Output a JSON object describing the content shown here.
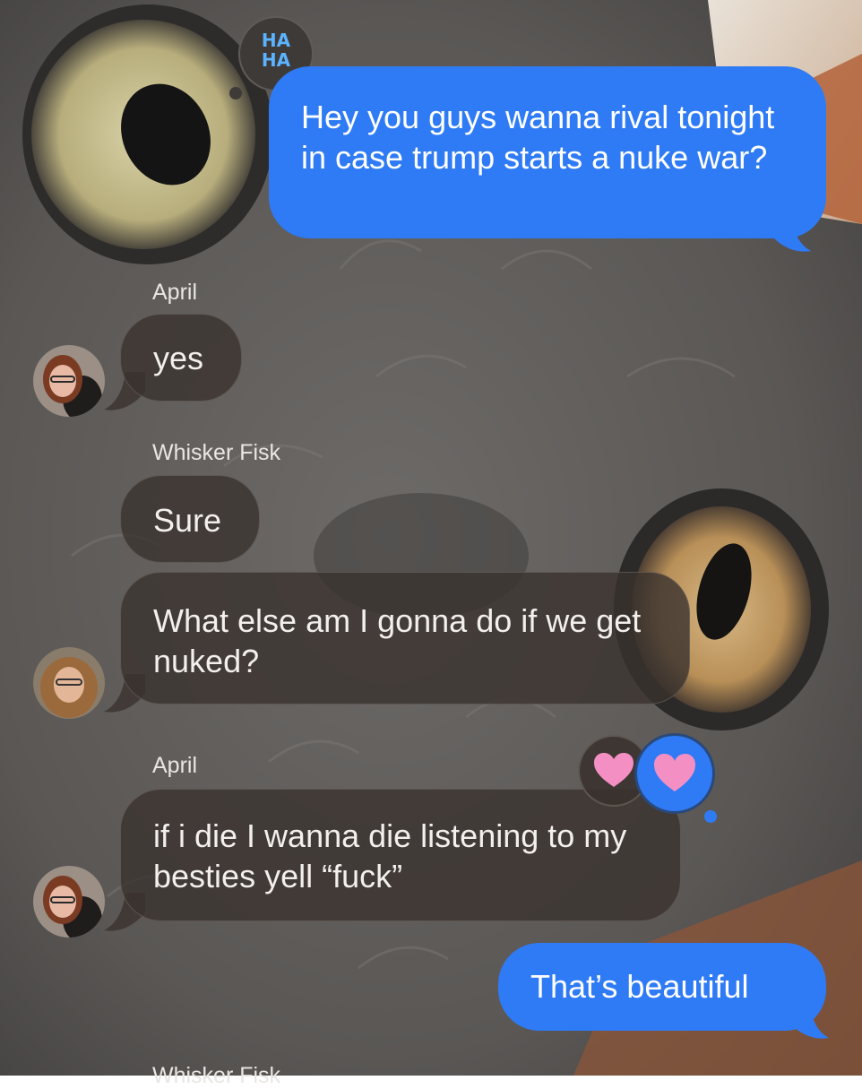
{
  "messages": {
    "m1": {
      "text": "Hey you guys wanna rival tonight in case trump starts a nuke war?",
      "reaction": "HA HA"
    },
    "m2": {
      "sender": "April",
      "text": "yes"
    },
    "m3": {
      "sender": "Whisker Fisk",
      "text": "Sure"
    },
    "m4": {
      "text": "What else am I gonna do if we get nuked?"
    },
    "m5": {
      "sender": "April",
      "text": "if i die I wanna die listening to my besties yell “fuck”",
      "reactions": [
        "heart",
        "heart"
      ]
    },
    "m6": {
      "text": "That’s beautiful"
    },
    "m7": {
      "sender": "Whisker Fisk"
    }
  },
  "colors": {
    "sent_bubble": "#2f7bf5",
    "received_bubble": "#3a322e",
    "reaction_pink": "#f48fc4"
  }
}
